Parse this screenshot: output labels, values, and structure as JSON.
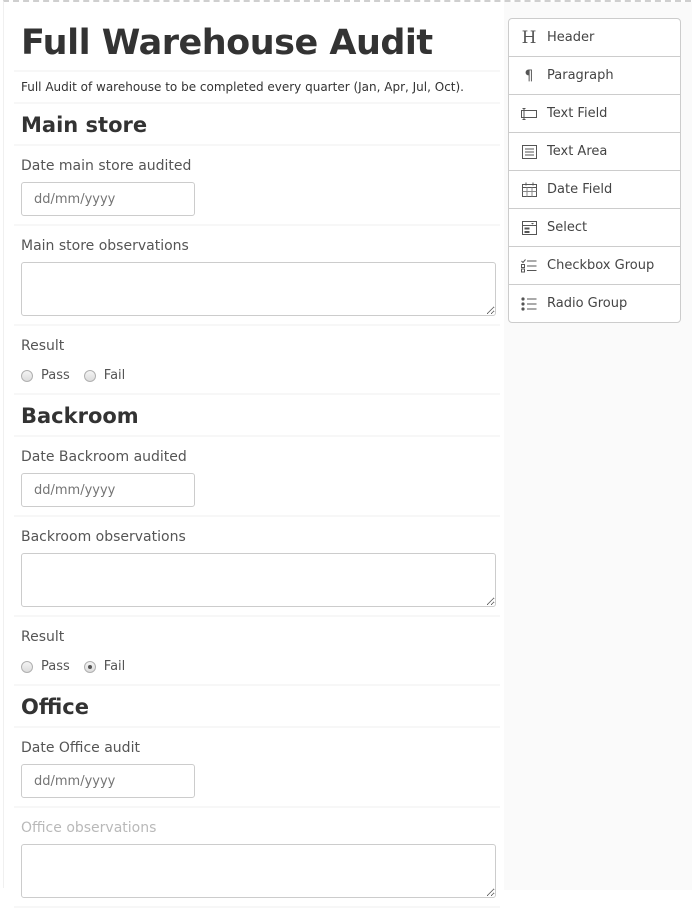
{
  "form": {
    "title": "Full Warehouse Audit",
    "description": "Full Audit of warehouse to be completed every quarter (Jan, Apr, Jul, Oct).",
    "sections": {
      "main": {
        "header": "Main store",
        "date_label": "Date main store audited",
        "date_placeholder": "dd/mm/yyyy",
        "obs_label": "Main store observations",
        "result_label": "Result",
        "options": [
          "Pass",
          "Fail"
        ],
        "selected": ""
      },
      "backroom": {
        "header": "Backroom",
        "date_label": "Date Backroom audited",
        "date_placeholder": "dd/mm/yyyy",
        "obs_label": "Backroom observations",
        "result_label": "Result",
        "options": [
          "Pass",
          "Fail"
        ],
        "selected": "Fail"
      },
      "office": {
        "header": "Office",
        "date_label": "Date Office audit",
        "date_placeholder": "dd/mm/yyyy",
        "obs_label": "Office observations"
      }
    }
  },
  "controls": [
    {
      "label": "Header",
      "icon": "header-icon"
    },
    {
      "label": "Paragraph",
      "icon": "paragraph-icon"
    },
    {
      "label": "Text Field",
      "icon": "text-field-icon"
    },
    {
      "label": "Text Area",
      "icon": "text-area-icon"
    },
    {
      "label": "Date Field",
      "icon": "calendar-icon"
    },
    {
      "label": "Select",
      "icon": "select-icon"
    },
    {
      "label": "Checkbox Group",
      "icon": "checkbox-group-icon"
    },
    {
      "label": "Radio Group",
      "icon": "radio-group-icon"
    }
  ]
}
